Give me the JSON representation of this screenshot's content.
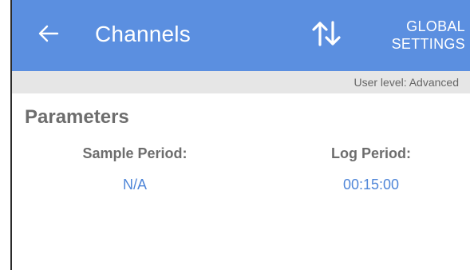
{
  "app_bar": {
    "back_icon": "arrow-left-icon",
    "title": "Channels",
    "sort_icon": "sort-up-down-icon",
    "global_settings_line1": "GLOBAL",
    "global_settings_line2": "SETTINGS",
    "background_color": "#5b8fe0"
  },
  "status_bar": {
    "user_level": "User level: Advanced"
  },
  "parameters": {
    "section_title": "Parameters",
    "sample_period_label": "Sample Period:",
    "sample_period_value": "N/A",
    "log_period_label": "Log Period:",
    "log_period_value": "00:15:00",
    "value_color": "#4f86d8"
  }
}
